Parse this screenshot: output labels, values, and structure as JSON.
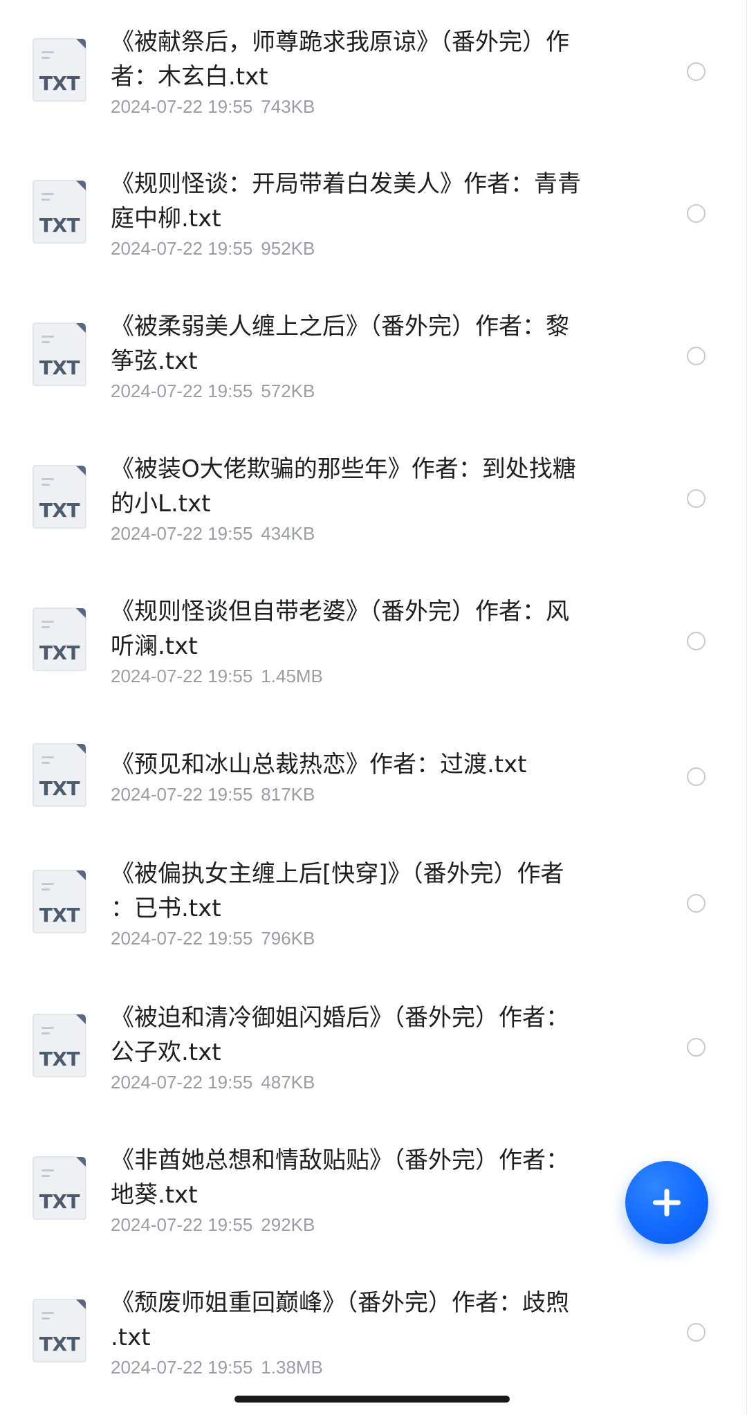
{
  "icons": {
    "file": "txt-file-icon",
    "select": "radio-circle-icon",
    "fab": "plus-icon"
  },
  "colors": {
    "accent": "#1169ff",
    "title": "#1f1f1f",
    "meta": "#9a9da3",
    "icon_body": "#eef0f3",
    "icon_text": "#4e5a6d",
    "icon_fold": "#5a6780"
  },
  "files": [
    {
      "type": "TXT",
      "name_line1": "《被献祭后，师尊跪求我原谅》（番外完）作",
      "name_line2": "者：木玄白.txt",
      "date": "2024-07-22 19:55",
      "size": "743KB"
    },
    {
      "type": "TXT",
      "name_line1": "《规则怪谈：开局带着白发美人》作者：青青",
      "name_line2": "庭中柳.txt",
      "date": "2024-07-22 19:55",
      "size": "952KB"
    },
    {
      "type": "TXT",
      "name_line1": "《被柔弱美人缠上之后》（番外完）作者：黎",
      "name_line2": "筝弦.txt",
      "date": "2024-07-22 19:55",
      "size": "572KB"
    },
    {
      "type": "TXT",
      "name_line1": "《被装O大佬欺骗的那些年》作者：到处找糖",
      "name_line2": "的小L.txt",
      "date": "2024-07-22 19:55",
      "size": "434KB"
    },
    {
      "type": "TXT",
      "name_line1": "《规则怪谈但自带老婆》（番外完）作者：风",
      "name_line2": "听澜.txt",
      "date": "2024-07-22 19:55",
      "size": "1.45MB"
    },
    {
      "type": "TXT",
      "name_line1": "《预见和冰山总裁热恋》作者：过渡.txt",
      "name_line2": "",
      "date": "2024-07-22 19:55",
      "size": "817KB"
    },
    {
      "type": "TXT",
      "name_line1": "《被偏执女主缠上后[快穿]》（番外完）作者",
      "name_line2": "：已书.txt",
      "date": "2024-07-22 19:55",
      "size": "796KB"
    },
    {
      "type": "TXT",
      "name_line1": "《被迫和清冷御姐闪婚后》（番外完）作者：",
      "name_line2": "公子欢.txt",
      "date": "2024-07-22 19:55",
      "size": "487KB"
    },
    {
      "type": "TXT",
      "name_line1": "《非酋她总想和情敌贴贴》（番外完）作者：",
      "name_line2": "地葵.txt",
      "date": "2024-07-22 19:55",
      "size": "292KB"
    },
    {
      "type": "TXT",
      "name_line1": "《颓废师姐重回巅峰》（番外完）作者：歧煦",
      "name_line2": ".txt",
      "date": "2024-07-22 19:55",
      "size": "1.38MB"
    }
  ]
}
